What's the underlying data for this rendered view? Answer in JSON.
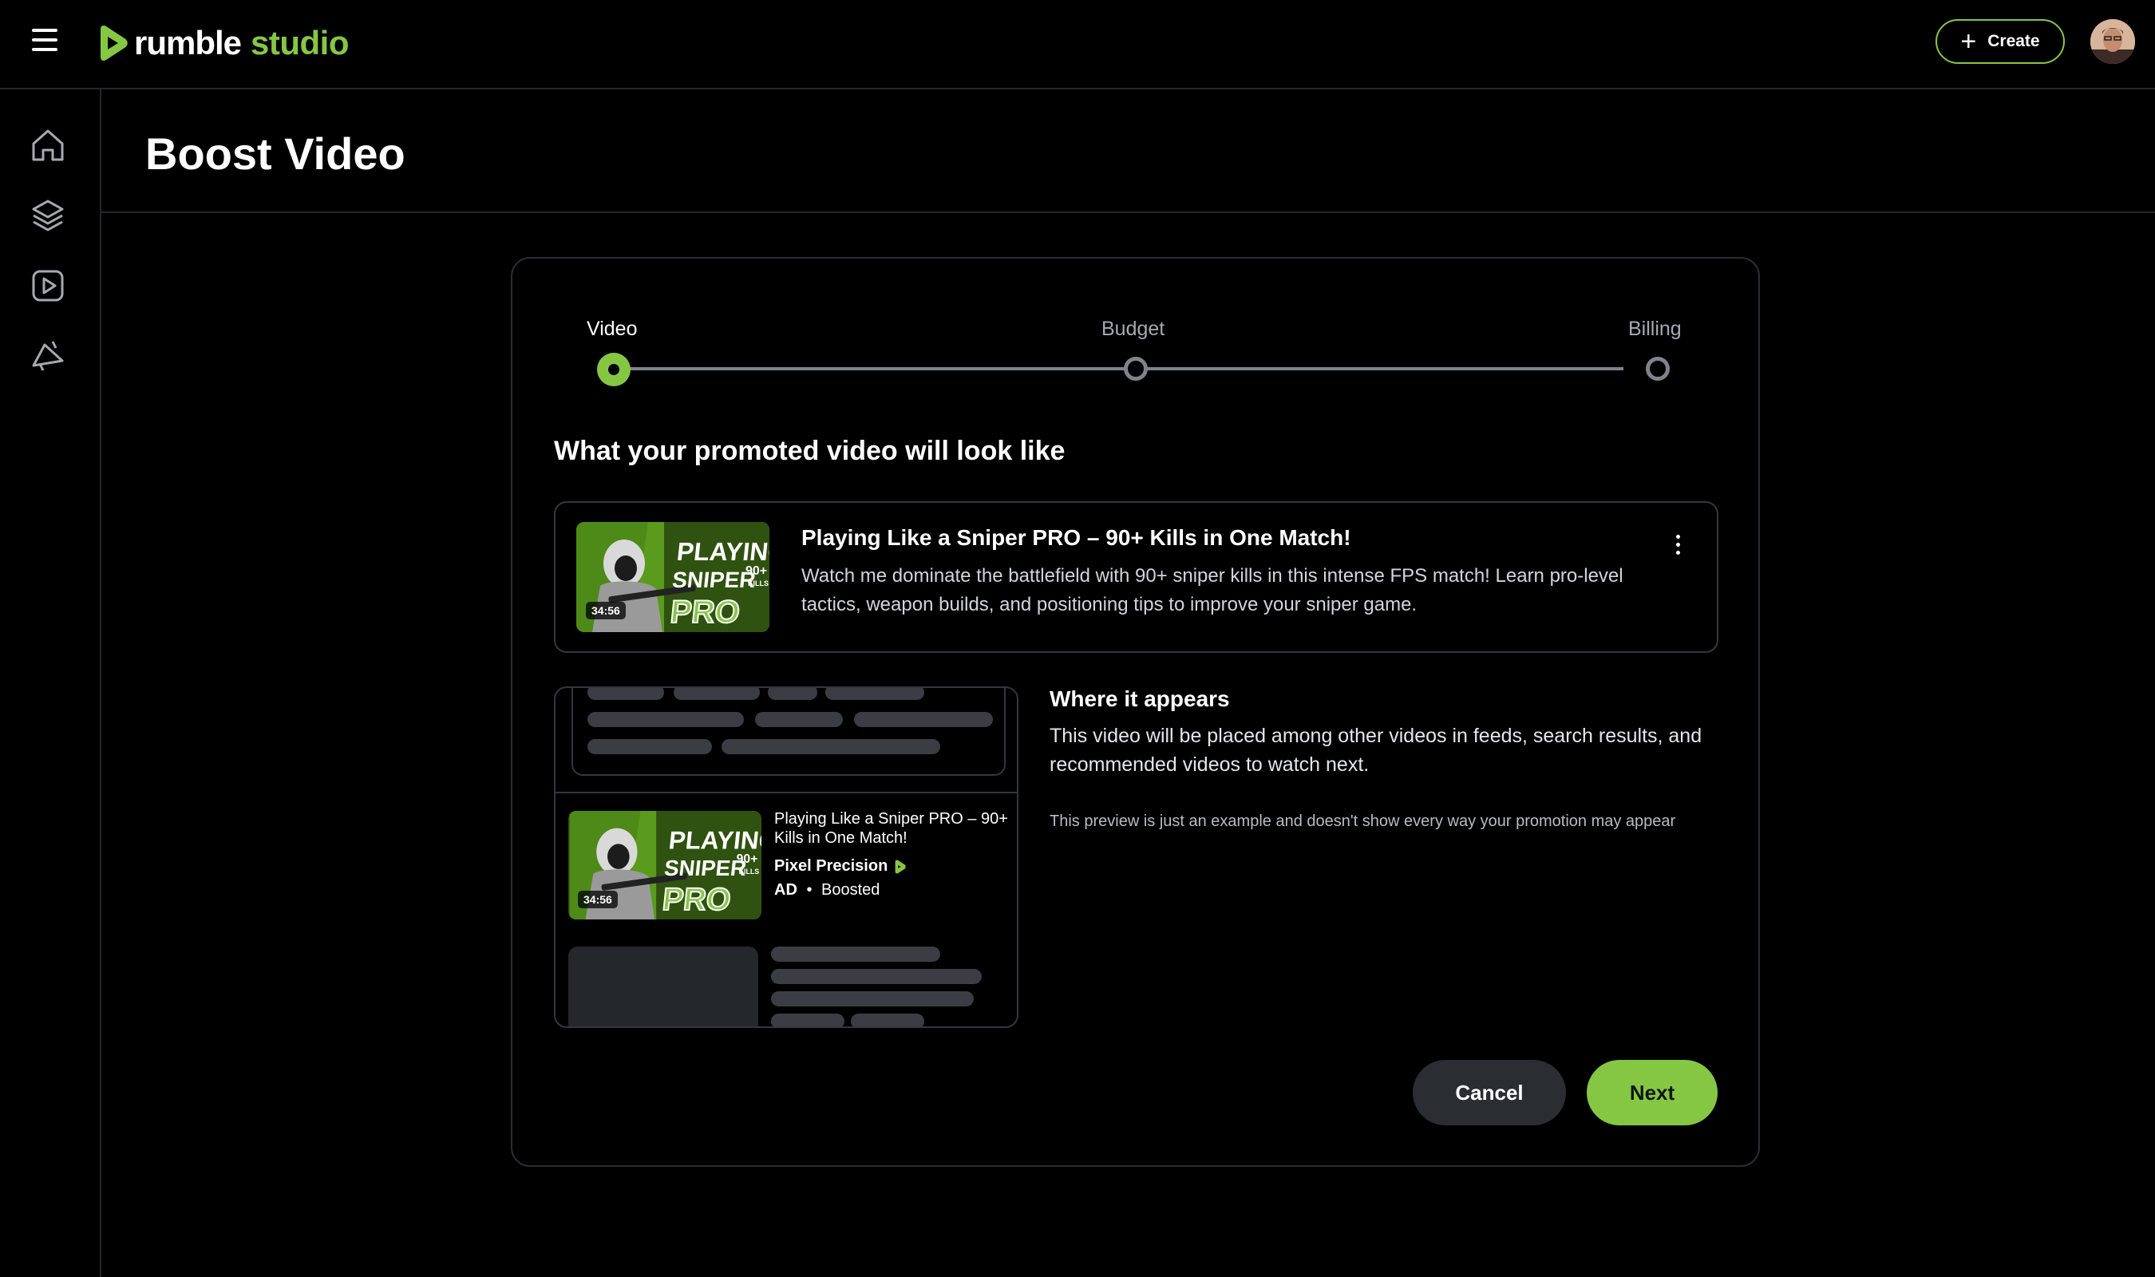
{
  "app": {
    "brand_word": "rumble",
    "brand_suffix": "studio",
    "create_label": "Create",
    "icons": [
      "menu-icon",
      "rumble-logo-icon",
      "plus-icon",
      "home-icon",
      "layers-icon",
      "video-icon",
      "megaphone-icon"
    ]
  },
  "page": {
    "title": "Boost Video"
  },
  "stepper": {
    "steps": [
      {
        "label": "Video",
        "state": "active"
      },
      {
        "label": "Budget",
        "state": "pending"
      },
      {
        "label": "Billing",
        "state": "pending"
      }
    ]
  },
  "preview_section": {
    "title": "What your promoted video will look like",
    "video": {
      "title": "Playing Like a Sniper PRO – 90+ Kills in One Match!",
      "description": "Watch me dominate the battlefield with 90+ sniper kills in this intense FPS match! Learn pro-level tactics, weapon builds, and positioning tips to improve your sniper game.",
      "duration": "34:56",
      "thumbnail_text_line1": "PLAYING",
      "thumbnail_text_line2": "SNIPER",
      "thumbnail_text_line3": "PRO",
      "thumbnail_badge": "90+",
      "thumbnail_badge_sub": "KILLS"
    },
    "feed_item": {
      "title": "Playing Like a Sniper PRO – 90+ Kills in One Match!",
      "channel": "Pixel Precision",
      "ad_label": "AD",
      "separator": "•",
      "status": "Boosted",
      "duration": "34:56"
    }
  },
  "where": {
    "title": "Where it appears",
    "description": "This video will be placed among other videos in feeds, search results, and recommended videos to watch next.",
    "note": "This preview is just an example and doesn't show every way your promotion may appear"
  },
  "actions": {
    "cancel_label": "Cancel",
    "next_label": "Next"
  },
  "colors": {
    "accent": "#85c742",
    "background": "#000000",
    "border": "#2a2d31",
    "muted": "#a4aab3"
  }
}
